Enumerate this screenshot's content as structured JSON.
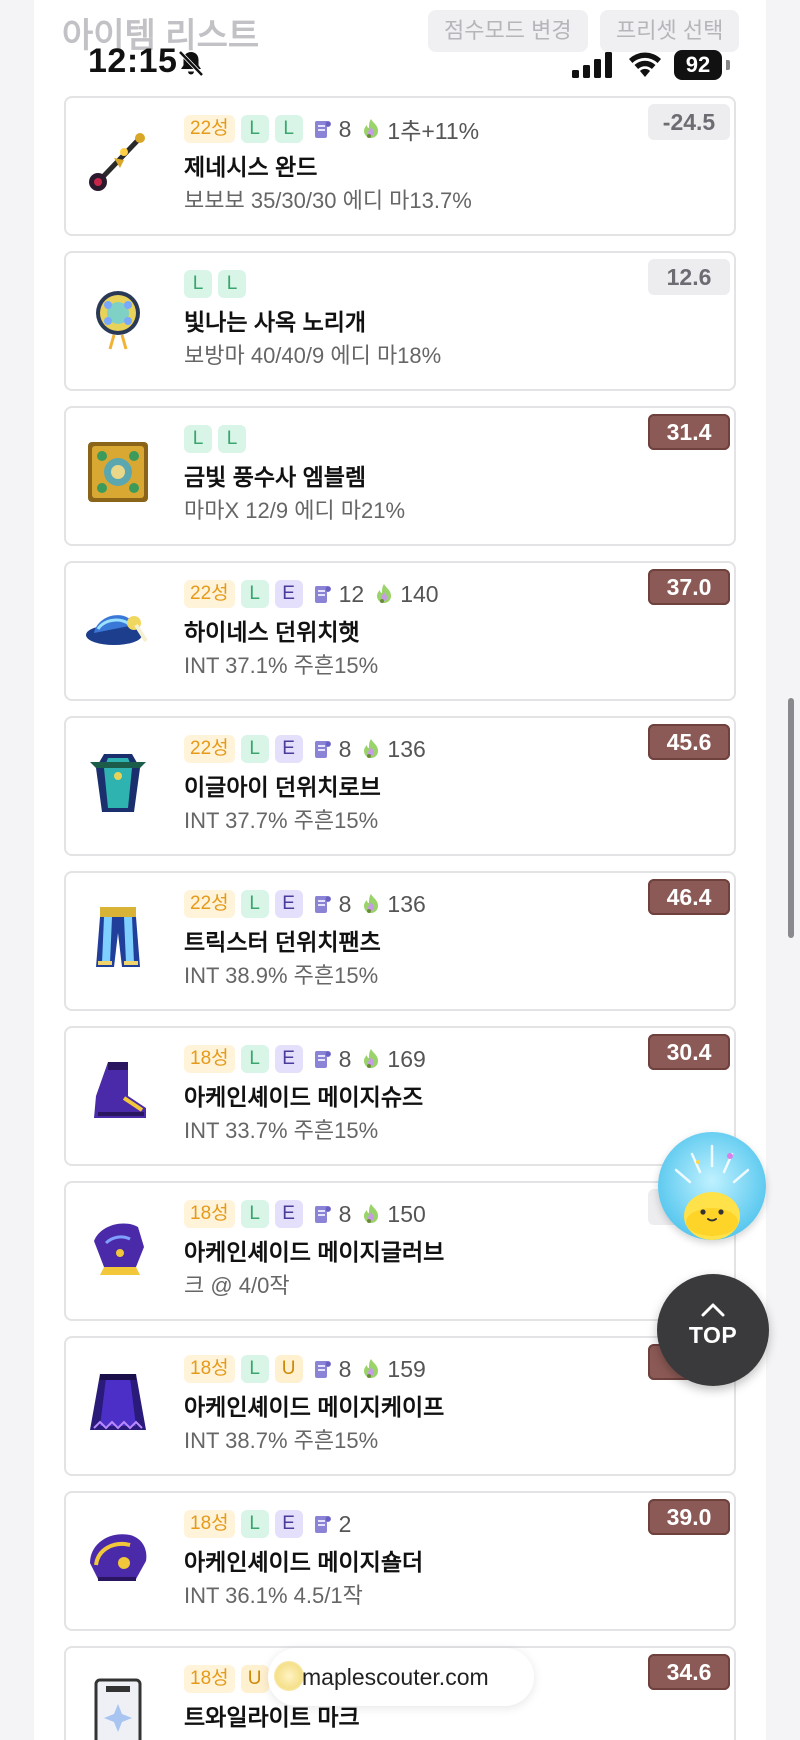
{
  "app": {
    "title": "아이템 리스트",
    "score_mode_button": "점수모드 변경",
    "preset_button": "프리셋 선택"
  },
  "status_bar": {
    "time": "12:15",
    "battery": "92"
  },
  "items": [
    {
      "star": "22성",
      "tags": [
        "L",
        "L"
      ],
      "scroll": "8",
      "flame": "1추+11%",
      "name": "제네시스 완드",
      "desc": "보보보 35/30/30 에디 마13.7%",
      "score": "-24.5",
      "score_style": "neutral",
      "icon": "genesis-wand-icon"
    },
    {
      "star": "",
      "tags": [
        "L",
        "L"
      ],
      "scroll": "",
      "flame": "",
      "name": "빛나는 사옥 노리개",
      "desc": "보방마 40/40/9 에디 마18%",
      "score": "12.6",
      "score_style": "neutral",
      "icon": "norigae-pendant-icon"
    },
    {
      "star": "",
      "tags": [
        "L",
        "L"
      ],
      "scroll": "",
      "flame": "",
      "name": "금빛 풍수사 엠블렘",
      "desc": "마마X 12/9 에디 마21%",
      "score": "31.4",
      "score_style": "brown",
      "icon": "emblem-icon"
    },
    {
      "star": "22성",
      "tags": [
        "L",
        "E"
      ],
      "scroll": "12",
      "flame": "140",
      "name": "하이네스 던위치햇",
      "desc": "INT 37.1%   주흔15%",
      "score": "37.0",
      "score_style": "brown",
      "icon": "hat-icon"
    },
    {
      "star": "22성",
      "tags": [
        "L",
        "E"
      ],
      "scroll": "8",
      "flame": "136",
      "name": "이글아이 던위치로브",
      "desc": "INT 37.7%   주흔15%",
      "score": "45.6",
      "score_style": "brown",
      "icon": "robe-icon"
    },
    {
      "star": "22성",
      "tags": [
        "L",
        "E"
      ],
      "scroll": "8",
      "flame": "136",
      "name": "트릭스터 던위치팬츠",
      "desc": "INT 38.9%   주흔15%",
      "score": "46.4",
      "score_style": "brown",
      "icon": "pants-icon"
    },
    {
      "star": "18성",
      "tags": [
        "L",
        "E"
      ],
      "scroll": "8",
      "flame": "169",
      "name": "아케인셰이드 메이지슈즈",
      "desc": "INT 33.7%   주흔15%",
      "score": "30.4",
      "score_style": "brown",
      "icon": "shoes-icon"
    },
    {
      "star": "18성",
      "tags": [
        "L",
        "E"
      ],
      "scroll": "8",
      "flame": "150",
      "name": "아케인셰이드 메이지글러브",
      "desc": "크 @   4/0작",
      "score": "",
      "score_style": "neutral",
      "icon": "glove-icon"
    },
    {
      "star": "18성",
      "tags": [
        "L",
        "U"
      ],
      "scroll": "8",
      "flame": "159",
      "name": "아케인셰이드 메이지케이프",
      "desc": "INT 38.7%   주흔15%",
      "score": "",
      "score_style": "brown",
      "icon": "cape-icon"
    },
    {
      "star": "18성",
      "tags": [
        "L",
        "E"
      ],
      "scroll": "2",
      "flame": "",
      "name": "아케인셰이드 메이지숄더",
      "desc": "INT 36.1%   4.5/1작",
      "score": "39.0",
      "score_style": "brown",
      "icon": "shoulder-icon"
    },
    {
      "star": "18성",
      "tags": [
        "U"
      ],
      "scroll": "",
      "flame": "",
      "name": "트와일라이트 마크",
      "desc": "",
      "score": "34.6",
      "score_style": "brown",
      "icon": "twilight-mark-icon"
    }
  ],
  "floating": {
    "top_label": "TOP",
    "site": "maplescouter.com"
  },
  "colors": {
    "score_brown": "#8c5a56",
    "tag_legendary": "#3aa56e",
    "tag_epic": "#4a3b9c",
    "tag_unique": "#cc8a08",
    "star_orange": "#e59a1a"
  }
}
